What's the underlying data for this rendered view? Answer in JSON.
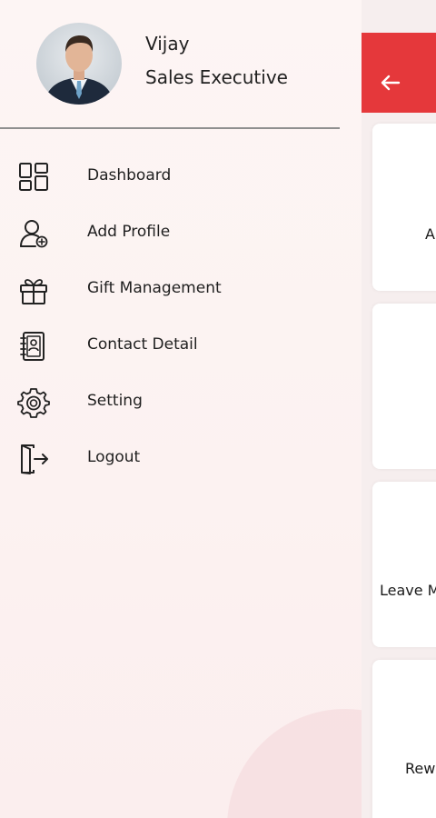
{
  "user": {
    "name": "Vijay",
    "role": "Sales Executive"
  },
  "menu": {
    "items": [
      {
        "label": "Dashboard",
        "icon": "dashboard-icon"
      },
      {
        "label": "Add Profile",
        "icon": "add-profile-icon"
      },
      {
        "label": "Gift Management",
        "icon": "gift-icon"
      },
      {
        "label": "Contact Detail",
        "icon": "contact-book-icon"
      },
      {
        "label": "Setting",
        "icon": "gear-icon"
      },
      {
        "label": "Logout",
        "icon": "logout-icon"
      }
    ]
  },
  "background_page": {
    "header_color": "#e5383b",
    "back_icon": "arrow-left-icon",
    "card_labels": [
      "A",
      "Leave M",
      "Rew"
    ]
  },
  "colors": {
    "accent": "#e5383b",
    "drawer_bg": "#fdf5f4",
    "divider": "#8f8f8f"
  }
}
